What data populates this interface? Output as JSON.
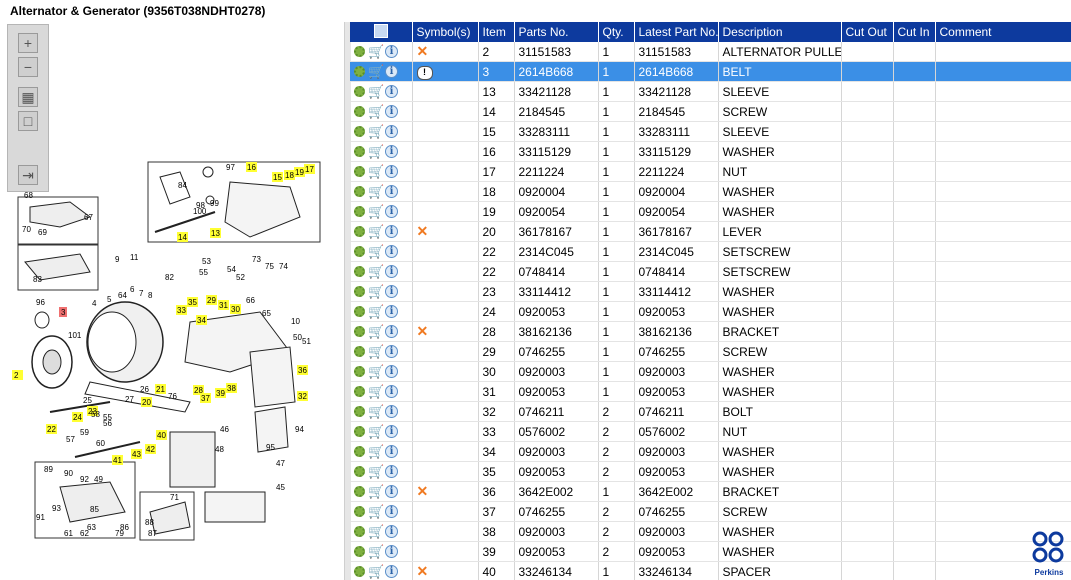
{
  "title": "Alternator & Generator (9356T038NDHT0278)",
  "columns": [
    "",
    "Symbol(s)",
    "Item",
    "Parts No.",
    "Qty.",
    "Latest Part No.",
    "Description",
    "Cut Out",
    "Cut In",
    "Comment"
  ],
  "rows": [
    {
      "symbol": "x",
      "item": "2",
      "part": "31151583",
      "qty": "1",
      "latest": "31151583",
      "desc": "ALTERNATOR PULLEY"
    },
    {
      "symbol": "warn",
      "item": "3",
      "part": "2614B668",
      "qty": "1",
      "latest": "2614B668",
      "desc": "BELT",
      "selected": true
    },
    {
      "symbol": "",
      "item": "13",
      "part": "33421128",
      "qty": "1",
      "latest": "33421128",
      "desc": "SLEEVE"
    },
    {
      "symbol": "",
      "item": "14",
      "part": "2184545",
      "qty": "1",
      "latest": "2184545",
      "desc": "SCREW"
    },
    {
      "symbol": "",
      "item": "15",
      "part": "33283111",
      "qty": "1",
      "latest": "33283111",
      "desc": "SLEEVE"
    },
    {
      "symbol": "",
      "item": "16",
      "part": "33115129",
      "qty": "1",
      "latest": "33115129",
      "desc": "WASHER"
    },
    {
      "symbol": "",
      "item": "17",
      "part": "2211224",
      "qty": "1",
      "latest": "2211224",
      "desc": "NUT"
    },
    {
      "symbol": "",
      "item": "18",
      "part": "0920004",
      "qty": "1",
      "latest": "0920004",
      "desc": "WASHER"
    },
    {
      "symbol": "",
      "item": "19",
      "part": "0920054",
      "qty": "1",
      "latest": "0920054",
      "desc": "WASHER"
    },
    {
      "symbol": "x",
      "item": "20",
      "part": "36178167",
      "qty": "1",
      "latest": "36178167",
      "desc": "LEVER"
    },
    {
      "symbol": "",
      "item": "22",
      "part": "2314C045",
      "qty": "1",
      "latest": "2314C045",
      "desc": "SETSCREW"
    },
    {
      "symbol": "",
      "item": "22",
      "part": "0748414",
      "qty": "1",
      "latest": "0748414",
      "desc": "SETSCREW"
    },
    {
      "symbol": "",
      "item": "23",
      "part": "33114412",
      "qty": "1",
      "latest": "33114412",
      "desc": "WASHER"
    },
    {
      "symbol": "",
      "item": "24",
      "part": "0920053",
      "qty": "1",
      "latest": "0920053",
      "desc": "WASHER"
    },
    {
      "symbol": "x",
      "item": "28",
      "part": "38162136",
      "qty": "1",
      "latest": "38162136",
      "desc": "BRACKET"
    },
    {
      "symbol": "",
      "item": "29",
      "part": "0746255",
      "qty": "1",
      "latest": "0746255",
      "desc": "SCREW"
    },
    {
      "symbol": "",
      "item": "30",
      "part": "0920003",
      "qty": "1",
      "latest": "0920003",
      "desc": "WASHER"
    },
    {
      "symbol": "",
      "item": "31",
      "part": "0920053",
      "qty": "1",
      "latest": "0920053",
      "desc": "WASHER"
    },
    {
      "symbol": "",
      "item": "32",
      "part": "0746211",
      "qty": "2",
      "latest": "0746211",
      "desc": "BOLT"
    },
    {
      "symbol": "",
      "item": "33",
      "part": "0576002",
      "qty": "2",
      "latest": "0576002",
      "desc": "NUT"
    },
    {
      "symbol": "",
      "item": "34",
      "part": "0920003",
      "qty": "2",
      "latest": "0920003",
      "desc": "WASHER"
    },
    {
      "symbol": "",
      "item": "35",
      "part": "0920053",
      "qty": "2",
      "latest": "0920053",
      "desc": "WASHER"
    },
    {
      "symbol": "x",
      "item": "36",
      "part": "3642E002",
      "qty": "1",
      "latest": "3642E002",
      "desc": "BRACKET"
    },
    {
      "symbol": "",
      "item": "37",
      "part": "0746255",
      "qty": "2",
      "latest": "0746255",
      "desc": "SCREW"
    },
    {
      "symbol": "",
      "item": "38",
      "part": "0920003",
      "qty": "2",
      "latest": "0920003",
      "desc": "WASHER"
    },
    {
      "symbol": "",
      "item": "39",
      "part": "0920053",
      "qty": "2",
      "latest": "0920053",
      "desc": "WASHER"
    },
    {
      "symbol": "x",
      "item": "40",
      "part": "33246134",
      "qty": "1",
      "latest": "33246134",
      "desc": "SPACER"
    }
  ],
  "callouts_plain": [
    "97",
    "84",
    "98",
    "100",
    "99",
    "68",
    "67",
    "70",
    "69",
    "83",
    "9",
    "11",
    "53",
    "55",
    "54",
    "52",
    "73",
    "75",
    "74",
    "82",
    "96",
    "101",
    "4",
    "5",
    "64",
    "6",
    "7",
    "8",
    "66",
    "65",
    "10",
    "27",
    "26",
    "76",
    "25",
    "58",
    "55",
    "56",
    "57",
    "59",
    "60",
    "50",
    "51",
    "94",
    "46",
    "48",
    "95",
    "71",
    "47",
    "45",
    "89",
    "90",
    "92",
    "49",
    "91",
    "93",
    "85",
    "63",
    "88",
    "87",
    "61",
    "62",
    "79",
    "86"
  ],
  "callouts_yellow": [
    "16",
    "15",
    "18",
    "19",
    "17",
    "14",
    "13",
    "35",
    "29",
    "31",
    "33",
    "34",
    "30",
    "36",
    "2",
    "21",
    "20",
    "28",
    "37",
    "39",
    "38",
    "32",
    "23",
    "24",
    "22",
    "40",
    "42",
    "43",
    "41"
  ],
  "callout_red": "3",
  "logo_text": "Perkins"
}
